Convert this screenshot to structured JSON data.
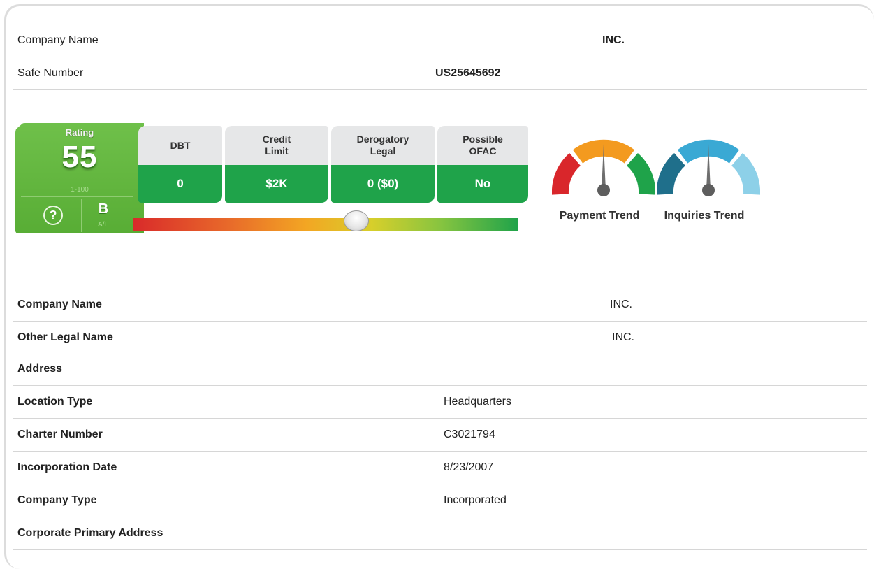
{
  "header_rows": [
    {
      "label": "Company Name",
      "value": "INC."
    },
    {
      "label": "Safe Number",
      "value": "US25645692"
    }
  ],
  "rating": {
    "label": "Rating",
    "score": "55",
    "range": "1-100",
    "grade": "B",
    "grade_scale": "A/E"
  },
  "metrics": [
    {
      "label": "DBT",
      "value": "0"
    },
    {
      "label": "Credit Limit",
      "value": "$2K"
    },
    {
      "label": "Derogatory Legal",
      "value": "0 ($0)"
    },
    {
      "label": "Possible OFAC",
      "value": "No"
    }
  ],
  "gauges": [
    {
      "label": "Payment Trend",
      "colors": [
        "#d9262b",
        "#f39a1f",
        "#1fa34a"
      ]
    },
    {
      "label": "Inquiries Trend",
      "colors": [
        "#1f6f8b",
        "#3aa9d4",
        "#8dd0e8"
      ]
    }
  ],
  "detail_rows": [
    {
      "label": "Company Name",
      "value": "INC."
    },
    {
      "label": "Other Legal Name",
      "value": "INC."
    },
    {
      "label": "Address",
      "value": ""
    },
    {
      "label": "Location Type",
      "value": "Headquarters"
    },
    {
      "label": "Charter Number",
      "value": "C3021794"
    },
    {
      "label": "Incorporation Date",
      "value": "8/23/2007"
    },
    {
      "label": "Company Type",
      "value": "Incorporated"
    },
    {
      "label": "Corporate Primary Address",
      "value": ""
    }
  ],
  "colors": {
    "rating_green": "#58ad35",
    "metric_green": "#1fa34a",
    "tile_grey": "#e6e7e8"
  }
}
